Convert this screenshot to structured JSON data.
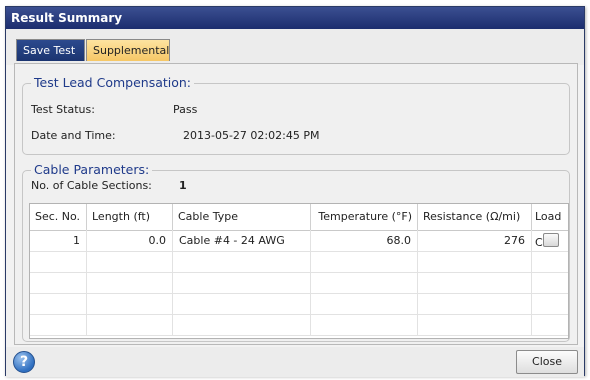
{
  "window": {
    "title": "Result Summary"
  },
  "tabs": [
    {
      "label": "Save Test"
    },
    {
      "label": "Supplemental"
    }
  ],
  "lead_comp": {
    "legend": "Test Lead Compensation:",
    "status_label": "Test Status:",
    "status_value": "Pass",
    "datetime_label": "Date and Time:",
    "datetime_value": "2013-05-27 02:02:45 PM"
  },
  "cable": {
    "legend": "Cable Parameters:",
    "sections_label": "No. of Cable Sections:",
    "sections_value": "1",
    "columns": [
      "Sec. No.",
      "Length (ft)",
      "Cable Type",
      "Temperature (°F)",
      "Resistance (Ω/mi)",
      "Load Coil"
    ],
    "rows": [
      {
        "sec": "1",
        "length": "0.0",
        "type": "Cable #4 - 24 AWG",
        "temperature": "68.0",
        "resistance": "276",
        "load_coil": false
      }
    ]
  },
  "footer": {
    "help_icon": "question-circle-icon",
    "close_label": "Close"
  }
}
